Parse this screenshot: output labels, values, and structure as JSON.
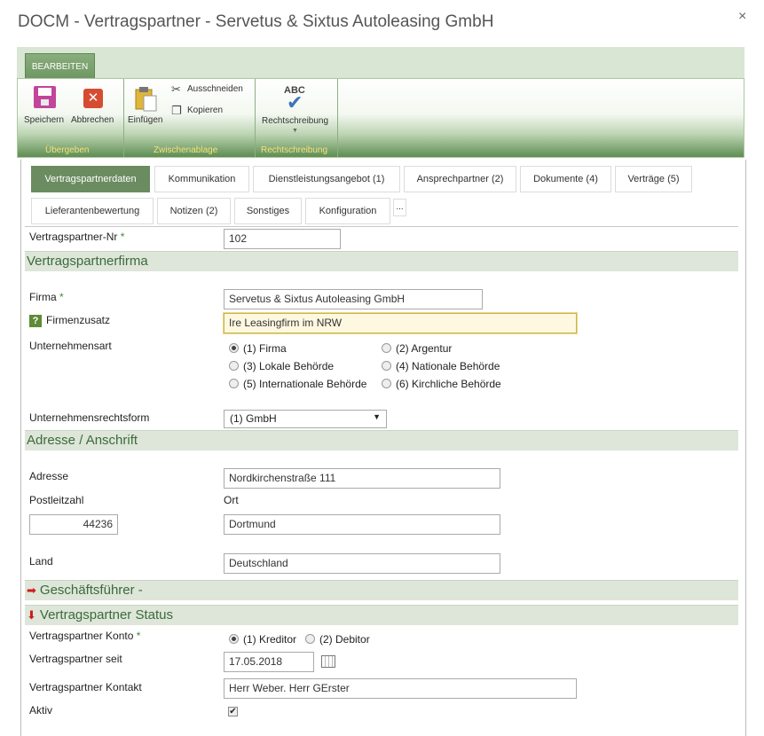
{
  "window": {
    "title": "DOCM - Vertragspartner - Servetus & Sixtus Autoleasing GmbH",
    "close_glyph": "×"
  },
  "ribbon": {
    "tab_label": "BEARBEITEN",
    "save_label": "Speichern",
    "cancel_label": "Abbrechen",
    "paste_label": "Einfügen",
    "cut_label": "Ausschneiden",
    "copy_label": "Kopieren",
    "spell_abc": "ABC",
    "spell_label": "Rechtschreibung",
    "group_submit": "Übergeben",
    "group_clipboard": "Zwischenablage",
    "group_spelling": "Rechtschreibung"
  },
  "tabs": {
    "row1": [
      "Vertragspartnerdaten",
      "Kommunikation",
      "Dienstleistungsangebot (1)",
      "Ansprechpartner (2)",
      "Dokumente (4)",
      "Verträge (5)"
    ],
    "row2": [
      "Lieferantenbewertung",
      "Notizen (2)",
      "Sonstiges",
      "Konfiguration",
      "..."
    ]
  },
  "form": {
    "partner_nr_label": "Vertragspartner-Nr",
    "partner_nr_value": "102",
    "required_mark": "*",
    "section_firma": "Vertragspartnerfirma",
    "firma_label": "Firma",
    "firma_value": "Servetus & Sixtus Autoleasing GmbH",
    "help_glyph": "?",
    "firmenzusatz_label": "Firmenzusatz",
    "firmenzusatz_value": "Ire Leasingfirm im NRW",
    "unternehmensart_label": "Unternehmensart",
    "unternehmensart_options": [
      "(1) Firma",
      "(2) Argentur",
      "(3) Lokale Behörde",
      "(4) Nationale Behörde",
      "(5) Internationale Behörde",
      "(6) Kirchliche Behörde"
    ],
    "unternehmensart_selected": "(1) Firma",
    "rechtsform_label": "Unternehmensrechtsform",
    "rechtsform_value": "(1) GmbH",
    "section_adresse": "Adresse / Anschrift",
    "adresse_label": "Adresse",
    "adresse_value": "Nordkirchenstraße 111",
    "plz_label": "Postleitzahl",
    "plz_value": "44236",
    "ort_label": "Ort",
    "ort_value": "Dortmund",
    "land_label": "Land",
    "land_value": "Deutschland",
    "section_geschaeftsfuehrer": "Geschäftsführer -",
    "section_status": "Vertragspartner Status",
    "konto_label": "Vertragspartner Konto",
    "konto_options": [
      "(1) Kreditor",
      "(2) Debitor"
    ],
    "konto_selected": "(1) Kreditor",
    "seit_label": "Vertragspartner seit",
    "seit_value": "17.05.2018",
    "kontakt_label": "Vertragspartner Kontakt",
    "kontakt_value": "Herr Weber. Herr GErster",
    "aktiv_label": "Aktiv",
    "aktiv_checked": true
  },
  "colors": {
    "accent_green": "#6a8c60",
    "section_text": "#3c6a3c",
    "required": "#3a8a3a",
    "arrow_red": "#d01a1a"
  },
  "icons": [
    "save-icon",
    "cancel-icon",
    "paste-icon",
    "scissors-icon",
    "copy-icon",
    "spellcheck-icon",
    "help-icon",
    "calendar-icon",
    "arrow-right-icon",
    "arrow-down-icon",
    "close-icon"
  ]
}
